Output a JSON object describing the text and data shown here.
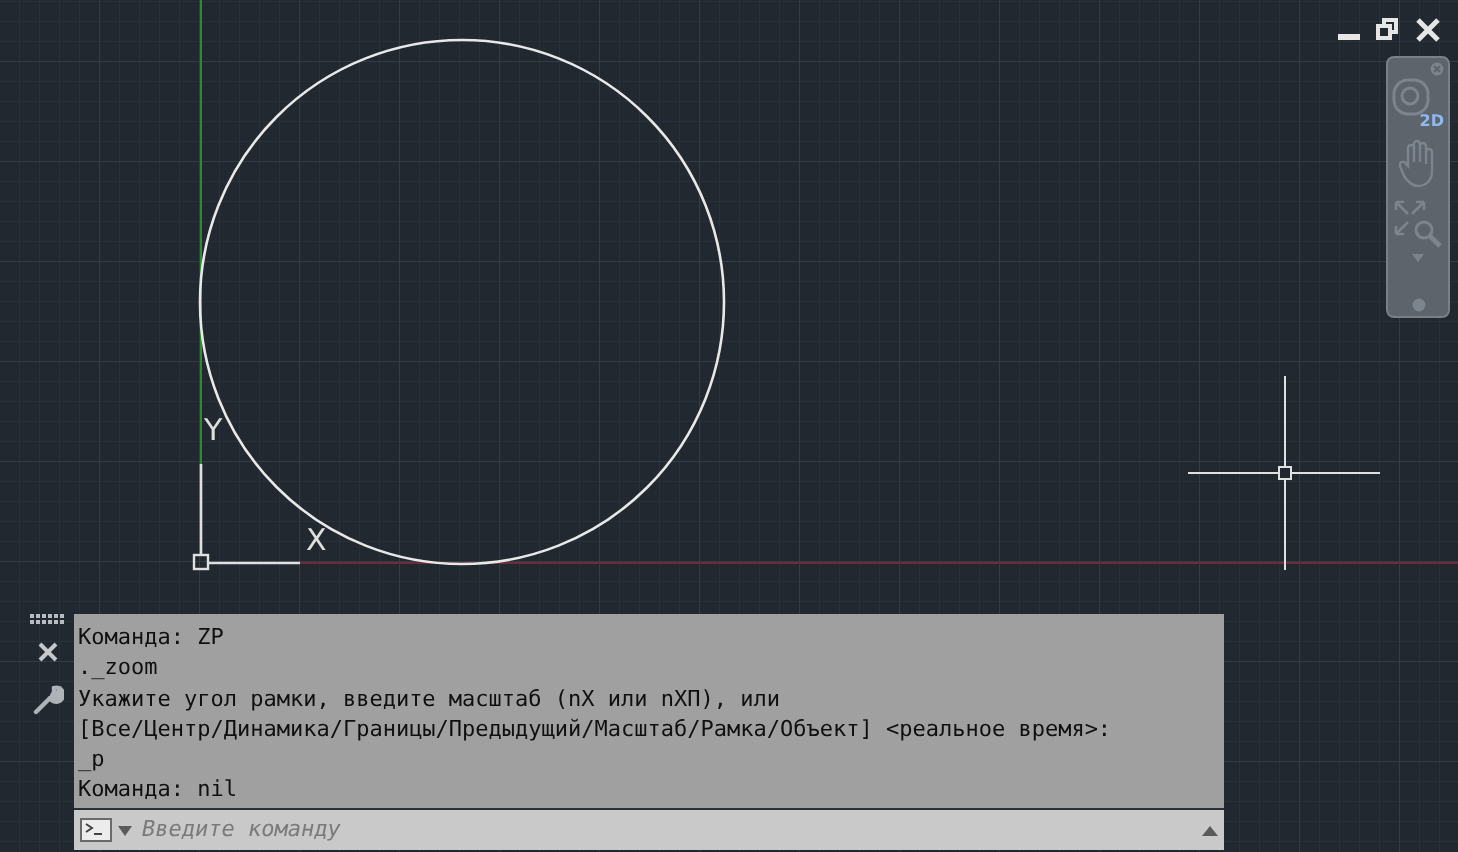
{
  "ucs": {
    "x_label": "X",
    "y_label": "Y"
  },
  "navigation_bar": {
    "badge": "2D"
  },
  "command_history": [
    "Команда: ZP",
    "._zoom",
    "Укажите угол рамки, введите масштаб (nX или nXП), или",
    "[Все/Центр/Динамика/Границы/Предыдущий/Масштаб/Рамка/Объект] <реальное время>:",
    "_p",
    "Команда: nil"
  ],
  "command_input": {
    "placeholder": "Введите команду"
  }
}
